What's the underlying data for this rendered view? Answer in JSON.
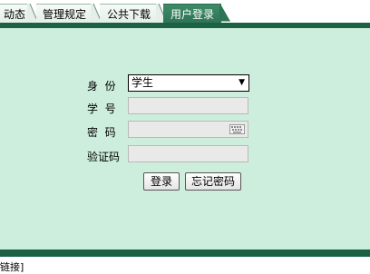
{
  "tabs": [
    {
      "label": "动态",
      "active": false
    },
    {
      "label": "管理规定",
      "active": false
    },
    {
      "label": "公共下载",
      "active": false
    },
    {
      "label": "用户登录",
      "active": true
    }
  ],
  "form": {
    "identity_label": "身  份",
    "identity_selected": "学生",
    "id_label": "学  号",
    "password_label": "密  码",
    "captcha_label": "验证码",
    "id_value": "",
    "password_value": "",
    "captcha_value": ""
  },
  "buttons": {
    "login": "登录",
    "forgot": "忘记密码"
  },
  "footer": {
    "text": "链接]"
  },
  "colors": {
    "panel_bg": "#cdeedd",
    "bar_dark": "#1d6144",
    "tab_active": "#2d7455"
  },
  "icons": {
    "keyboard": "keyboard-icon",
    "dropdown": "dropdown-arrow-icon"
  }
}
